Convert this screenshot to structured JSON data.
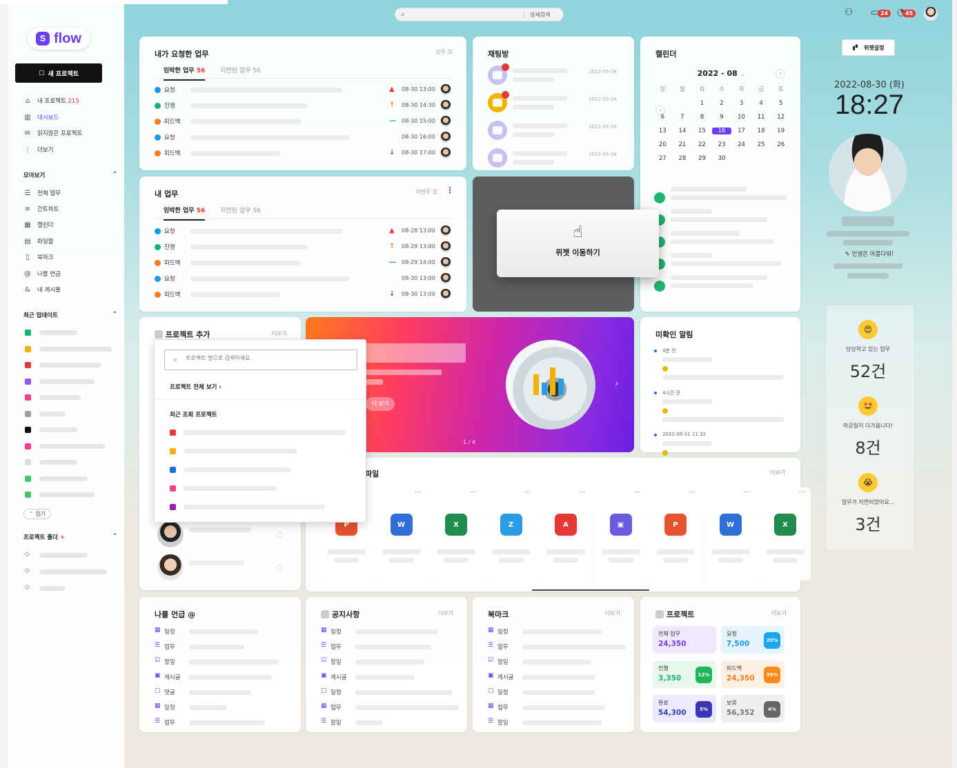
{
  "topbar": {
    "search_button": "상세검색",
    "badges": [
      "24",
      "45"
    ]
  },
  "sidebar": {
    "logo": "flow",
    "new_project": "새 프로젝트",
    "nav": [
      {
        "label": "내 프로젝트",
        "count": "215",
        "icon": "home-icon"
      },
      {
        "label": "대시보드",
        "icon": "dashboard-icon",
        "active": true
      },
      {
        "label": "읽지않은 프로젝트",
        "icon": "mail-icon"
      },
      {
        "label": "더보기",
        "icon": "more-vertical-icon"
      }
    ],
    "collect_title": "모아보기",
    "collect": [
      {
        "label": "전체 업무",
        "icon": "list-icon"
      },
      {
        "label": "간트차트",
        "icon": "gantt-icon"
      },
      {
        "label": "캘린더",
        "icon": "calendar-icon"
      },
      {
        "label": "파일함",
        "icon": "file-icon"
      },
      {
        "label": "북마크",
        "icon": "bookmark-icon"
      },
      {
        "label": "나를 언급",
        "icon": "mention-icon"
      },
      {
        "label": "내 게시물",
        "icon": "my-posts-icon"
      }
    ],
    "recent_title": "최근 업데이트",
    "recent_colors": [
      "#19b46b",
      "#f0b400",
      "#e53935",
      "#8e5bf0",
      "#ff3d8b",
      "#9e9e9e",
      "#111111",
      "#ff3d8b",
      "#dddddd",
      "#46c46b",
      "#46c46b"
    ],
    "collapse": "접기",
    "folder_title": "프로젝트 폴더",
    "folder_add": "+"
  },
  "requested": {
    "title": "내가 요청한 업무",
    "more": "모두",
    "tab_urgent": "임박한 업무",
    "tab_urgent_count": "56",
    "tab_delayed": "지연된 업무 56",
    "rows": [
      {
        "status": "요청",
        "color": "#1a9ae6",
        "prio": "▲",
        "prio_color": "#e53935",
        "date": "08-30 13:00"
      },
      {
        "status": "진행",
        "color": "#19b46b",
        "prio": "↑",
        "prio_color": "#ff7a1a",
        "date": "08-30 14:30"
      },
      {
        "status": "피드백",
        "color": "#ff7a1a",
        "prio": "—",
        "prio_color": "#19b46b",
        "date": "08-30 15:00"
      },
      {
        "status": "요청",
        "color": "#1a9ae6",
        "prio": "",
        "prio_color": "#999",
        "date": "08-30 16:00"
      },
      {
        "status": "피드백",
        "color": "#ff7a1a",
        "prio": "↓",
        "prio_color": "#666",
        "date": "08-30 17:00"
      }
    ]
  },
  "mytasks": {
    "title": "내 업무",
    "more": "이번주",
    "tab_urgent": "임박한 업무",
    "tab_urgent_count": "56",
    "tab_delayed": "지연된 업무 56",
    "rows": [
      {
        "status": "요청",
        "color": "#1a9ae6",
        "prio": "▲",
        "prio_color": "#e53935",
        "date": "08-28 13:00"
      },
      {
        "status": "진행",
        "color": "#19b46b",
        "prio": "↑",
        "prio_color": "#ff7a1a",
        "date": "08-29 13:00"
      },
      {
        "status": "피드백",
        "color": "#ff7a1a",
        "prio": "—",
        "prio_color": "#19b46b",
        "date": "08-29 14:00"
      },
      {
        "status": "요청",
        "color": "#1a9ae6",
        "prio": "",
        "prio_color": "#999",
        "date": "08-30 13:00"
      },
      {
        "status": "피드백",
        "color": "#ff7a1a",
        "prio": "↓",
        "prio_color": "#666",
        "date": "08-30 13:00"
      }
    ]
  },
  "chat": {
    "title": "채팅방",
    "dates": [
      "2022-09-26",
      "2022-09-26",
      "2022-09-26",
      "2022-09-26"
    ],
    "icon_colors": [
      "#c9bff2",
      "#f0b400",
      "#c9bff2",
      "#c9bff2"
    ]
  },
  "move_widget": {
    "label": "위젯 이동하기"
  },
  "calendar": {
    "title": "캘린더",
    "month": "2022 - 08",
    "weekdays": [
      "일",
      "월",
      "화",
      "수",
      "목",
      "금",
      "토"
    ],
    "weeks": [
      [
        "",
        "",
        "1",
        "2",
        "3",
        "4",
        "5"
      ],
      [
        "6",
        "7",
        "8",
        "9",
        "10",
        "11",
        "12"
      ],
      [
        "13",
        "14",
        "15",
        "16",
        "17",
        "18",
        "19"
      ],
      [
        "20",
        "21",
        "22",
        "23",
        "24",
        "25",
        "26"
      ],
      [
        "27",
        "28",
        "29",
        "30",
        "",
        "",
        ""
      ]
    ],
    "today": "16"
  },
  "project_add": {
    "title": "프로젝트 추가",
    "more": "더보기",
    "search_placeholder": "프로젝트 명으로 검색하세요.",
    "view_all": "프로젝트 전체 보기 ›",
    "recent": "최근 조회 프로젝트",
    "colors": [
      "#e53935",
      "#f0b400",
      "#1a6fe6",
      "#ff3d8b",
      "#8e24aa"
    ]
  },
  "banner": {
    "button": "더 보기",
    "page": "1 / 4"
  },
  "unread": {
    "title": "미확인 알림",
    "items": [
      "4분 전",
      "4시간 전",
      "2022-08-31 11:32"
    ]
  },
  "files": {
    "title": "파일",
    "more": "더보기",
    "icons": [
      {
        "name": "powerpoint-icon",
        "color": "#e8532f",
        "glyph": "P"
      },
      {
        "name": "word-icon",
        "color": "#2f6fd6",
        "glyph": "W"
      },
      {
        "name": "excel-icon",
        "color": "#1f8c4e",
        "glyph": "X"
      },
      {
        "name": "zip-icon",
        "color": "#2c9be6",
        "glyph": "Z"
      },
      {
        "name": "pdf-icon",
        "color": "#e53935",
        "glyph": "A"
      },
      {
        "name": "image-file-icon",
        "color": "#6a5ae0",
        "glyph": "▣"
      },
      {
        "name": "powerpoint-icon",
        "color": "#e8532f",
        "glyph": "P"
      },
      {
        "name": "word-icon",
        "color": "#2f6fd6",
        "glyph": "W"
      },
      {
        "name": "excel-icon",
        "color": "#1f8c4e",
        "glyph": "X"
      }
    ]
  },
  "mentions": {
    "title": "나를 언급 @",
    "rows": [
      "일정",
      "업무",
      "할일",
      "게시글",
      "댓글",
      "일정",
      "업무"
    ]
  },
  "notice": {
    "title": "공지사항",
    "more": "더보기",
    "rows": [
      "일정",
      "업무",
      "할일",
      "게시글",
      "일정",
      "업무",
      "할일"
    ]
  },
  "bookmark": {
    "title": "북마크",
    "more": "더보기",
    "rows": [
      "일정",
      "업무",
      "할일",
      "게시글",
      "일정",
      "업무",
      "할일"
    ]
  },
  "project_stats": {
    "title": "프로젝트",
    "more": "더보기",
    "stats": [
      {
        "label": "전체 업무",
        "value": "24,350",
        "pct": "",
        "bg": "#f1e8ff",
        "vcolor": "#6a3ef2",
        "pcolor": ""
      },
      {
        "label": "요청",
        "value": "7,500",
        "pct": "20%",
        "bg": "#e4f3fd",
        "vcolor": "#1a9ae6",
        "pcolor": "#1aa7f0"
      },
      {
        "label": "진행",
        "value": "3,350",
        "pct": "12%",
        "bg": "#e7f7ee",
        "vcolor": "#19b46b",
        "pcolor": "#21b45b"
      },
      {
        "label": "피드백",
        "value": "24,350",
        "pct": "39%",
        "bg": "#fff0e4",
        "vcolor": "#ff7a1a",
        "pcolor": "#ff8a1a"
      },
      {
        "label": "완료",
        "value": "54,300",
        "pct": "5%",
        "bg": "#ebeaff",
        "vcolor": "#3b3fb8",
        "pcolor": "#3b35b8"
      },
      {
        "label": "보류",
        "value": "56,352",
        "pct": "4%",
        "bg": "#efefef",
        "vcolor": "#777",
        "pcolor": "#666"
      }
    ]
  },
  "right": {
    "widget_settings": "위젯설정",
    "date": "2022-08-30 (화)",
    "time": "18:27",
    "motto": "✎ 인생은 아름다워!",
    "counters": [
      {
        "label": "담당하고 있는 업무",
        "count": "52건",
        "emoji": "😍"
      },
      {
        "label": "마감일이 다가옵니다!",
        "count": "8건",
        "emoji": "🤩"
      },
      {
        "label": "업무가 지연되었어요...",
        "count": "3건",
        "emoji": "😭"
      }
    ]
  }
}
